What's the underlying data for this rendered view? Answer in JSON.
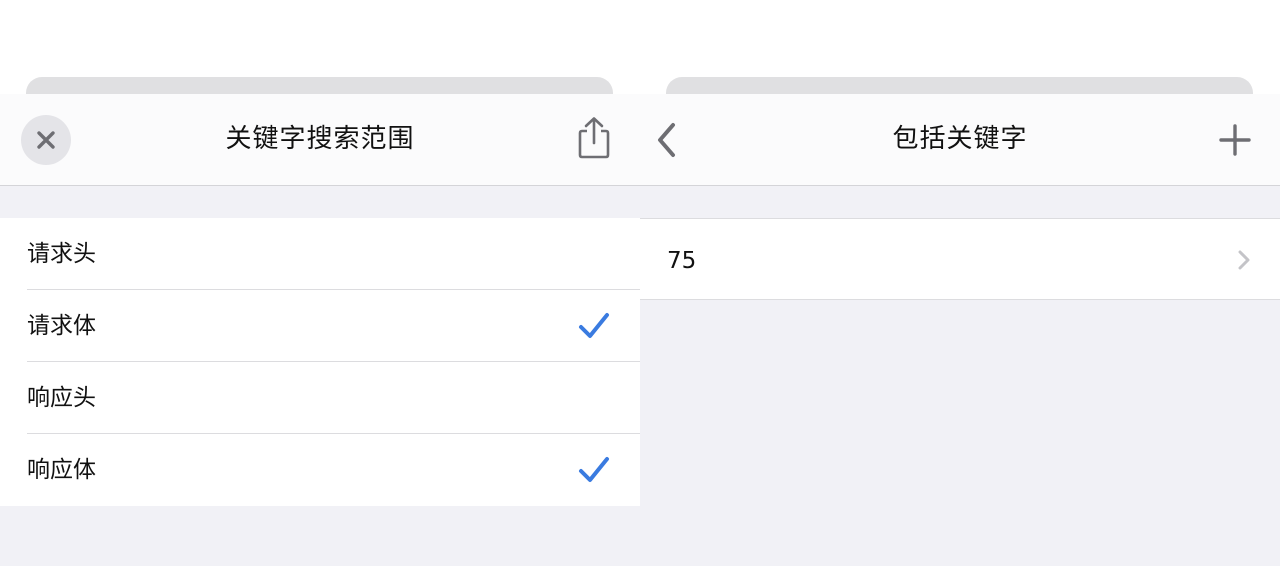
{
  "left_panel": {
    "title": "关键字搜索范围",
    "icons": {
      "close": "close-icon",
      "share": "share-icon",
      "check": "checkmark-icon"
    },
    "options": [
      {
        "label": "请求头",
        "checked": false
      },
      {
        "label": "请求体",
        "checked": true
      },
      {
        "label": "响应头",
        "checked": false
      },
      {
        "label": "响应体",
        "checked": true
      }
    ]
  },
  "right_panel": {
    "title": "包括关键字",
    "icons": {
      "back": "chevron-left-icon",
      "add": "plus-icon",
      "disclosure": "chevron-right-icon"
    },
    "keywords": [
      {
        "label": "75"
      }
    ]
  },
  "colors": {
    "accent": "#3a7be0",
    "nav_icon": "#6e6e73",
    "background": "#f1f1f6",
    "separator": "#dcdcdf"
  }
}
